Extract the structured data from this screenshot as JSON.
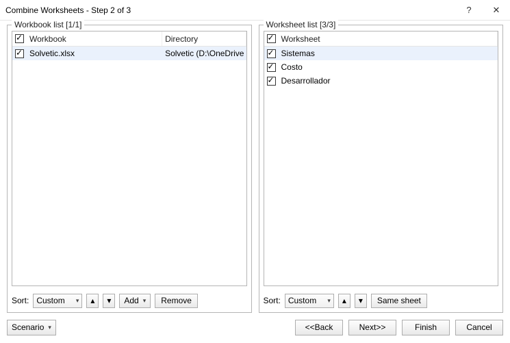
{
  "window": {
    "title": "Combine Worksheets - Step 2 of 3",
    "help": "?",
    "close": "✕"
  },
  "workbook_panel": {
    "legend": "Workbook list [1/1]",
    "headers": {
      "col1": "Workbook",
      "col2": "Directory"
    },
    "rows": [
      {
        "name": "Solvetic.xlsx",
        "dir": "Solvetic (D:\\OneDrive S...",
        "checked": true,
        "selected": true
      }
    ],
    "sort_label": "Sort:",
    "sort_value": "Custom",
    "add_label": "Add",
    "remove_label": "Remove"
  },
  "worksheet_panel": {
    "legend": "Worksheet list [3/3]",
    "headers": {
      "col1": "Worksheet"
    },
    "rows": [
      {
        "name": "Sistemas",
        "checked": true,
        "selected": true
      },
      {
        "name": "Costo",
        "checked": true,
        "selected": false
      },
      {
        "name": "Desarrollador",
        "checked": true,
        "selected": false
      }
    ],
    "sort_label": "Sort:",
    "sort_value": "Custom",
    "same_sheet_label": "Same sheet"
  },
  "footer": {
    "scenario": "Scenario",
    "back": "<<Back",
    "next": "Next>>",
    "finish": "Finish",
    "cancel": "Cancel"
  },
  "arrows": {
    "down": "▾",
    "up": "▴"
  }
}
